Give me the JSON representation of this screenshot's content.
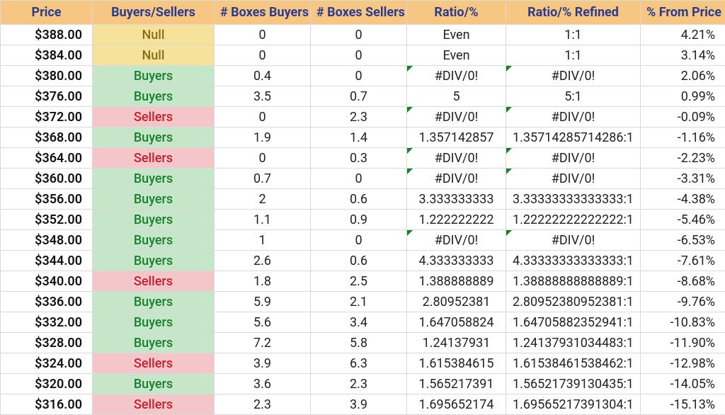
{
  "headers": {
    "price": "Price",
    "bs": "Buyers/Sellers",
    "nb": "# Boxes Buyers",
    "ns": "# Boxes Sellers",
    "ratio": "Ratio/%",
    "ratior": "Ratio/% Refined",
    "pct": "% From Price"
  },
  "bs_classes": {
    "Buyers": "bs-buyers",
    "Sellers": "bs-sellers",
    "Null": "bs-null"
  },
  "rows": [
    {
      "price": "$388.00",
      "bs": "Null",
      "nb": "0",
      "ns": "0",
      "ratio": "Even",
      "ratior": "1:1",
      "pct": "4.21%",
      "err": false
    },
    {
      "price": "$384.00",
      "bs": "Null",
      "nb": "0",
      "ns": "0",
      "ratio": "Even",
      "ratior": "1:1",
      "pct": "3.14%",
      "err": false
    },
    {
      "price": "$380.00",
      "bs": "Buyers",
      "nb": "0.4",
      "ns": "0",
      "ratio": "#DIV/0!",
      "ratior": "#DIV/0!",
      "pct": "2.06%",
      "err": true
    },
    {
      "price": "$376.00",
      "bs": "Buyers",
      "nb": "3.5",
      "ns": "0.7",
      "ratio": "5",
      "ratior": "5:1",
      "pct": "0.99%",
      "err": false
    },
    {
      "price": "$372.00",
      "bs": "Sellers",
      "nb": "0",
      "ns": "2.3",
      "ratio": "#DIV/0!",
      "ratior": "#DIV/0!",
      "pct": "-0.09%",
      "err": true
    },
    {
      "price": "$368.00",
      "bs": "Buyers",
      "nb": "1.9",
      "ns": "1.4",
      "ratio": "1.357142857",
      "ratior": "1.35714285714286:1",
      "pct": "-1.16%",
      "err": false
    },
    {
      "price": "$364.00",
      "bs": "Sellers",
      "nb": "0",
      "ns": "0.3",
      "ratio": "#DIV/0!",
      "ratior": "#DIV/0!",
      "pct": "-2.23%",
      "err": true
    },
    {
      "price": "$360.00",
      "bs": "Buyers",
      "nb": "0.7",
      "ns": "0",
      "ratio": "#DIV/0!",
      "ratior": "#DIV/0!",
      "pct": "-3.31%",
      "err": true
    },
    {
      "price": "$356.00",
      "bs": "Buyers",
      "nb": "2",
      "ns": "0.6",
      "ratio": "3.333333333",
      "ratior": "3.33333333333333:1",
      "pct": "-4.38%",
      "err": false
    },
    {
      "price": "$352.00",
      "bs": "Buyers",
      "nb": "1.1",
      "ns": "0.9",
      "ratio": "1.222222222",
      "ratior": "1.22222222222222:1",
      "pct": "-5.46%",
      "err": false
    },
    {
      "price": "$348.00",
      "bs": "Buyers",
      "nb": "1",
      "ns": "0",
      "ratio": "#DIV/0!",
      "ratior": "#DIV/0!",
      "pct": "-6.53%",
      "err": true
    },
    {
      "price": "$344.00",
      "bs": "Buyers",
      "nb": "2.6",
      "ns": "0.6",
      "ratio": "4.333333333",
      "ratior": "4.33333333333333:1",
      "pct": "-7.61%",
      "err": false
    },
    {
      "price": "$340.00",
      "bs": "Sellers",
      "nb": "1.8",
      "ns": "2.5",
      "ratio": "1.388888889",
      "ratior": "1.38888888888889:1",
      "pct": "-8.68%",
      "err": false
    },
    {
      "price": "$336.00",
      "bs": "Buyers",
      "nb": "5.9",
      "ns": "2.1",
      "ratio": "2.80952381",
      "ratior": "2.80952380952381:1",
      "pct": "-9.76%",
      "err": false
    },
    {
      "price": "$332.00",
      "bs": "Buyers",
      "nb": "5.6",
      "ns": "3.4",
      "ratio": "1.647058824",
      "ratior": "1.64705882352941:1",
      "pct": "-10.83%",
      "err": false
    },
    {
      "price": "$328.00",
      "bs": "Buyers",
      "nb": "7.2",
      "ns": "5.8",
      "ratio": "1.24137931",
      "ratior": "1.24137931034483:1",
      "pct": "-11.90%",
      "err": false
    },
    {
      "price": "$324.00",
      "bs": "Sellers",
      "nb": "3.9",
      "ns": "6.3",
      "ratio": "1.615384615",
      "ratior": "1.61538461538462:1",
      "pct": "-12.98%",
      "err": false
    },
    {
      "price": "$320.00",
      "bs": "Buyers",
      "nb": "3.6",
      "ns": "2.3",
      "ratio": "1.565217391",
      "ratior": "1.56521739130435:1",
      "pct": "-14.05%",
      "err": false
    },
    {
      "price": "$316.00",
      "bs": "Sellers",
      "nb": "2.3",
      "ns": "3.9",
      "ratio": "1.695652174",
      "ratior": "1.69565217391304:1",
      "pct": "-15.13%",
      "err": false
    }
  ]
}
